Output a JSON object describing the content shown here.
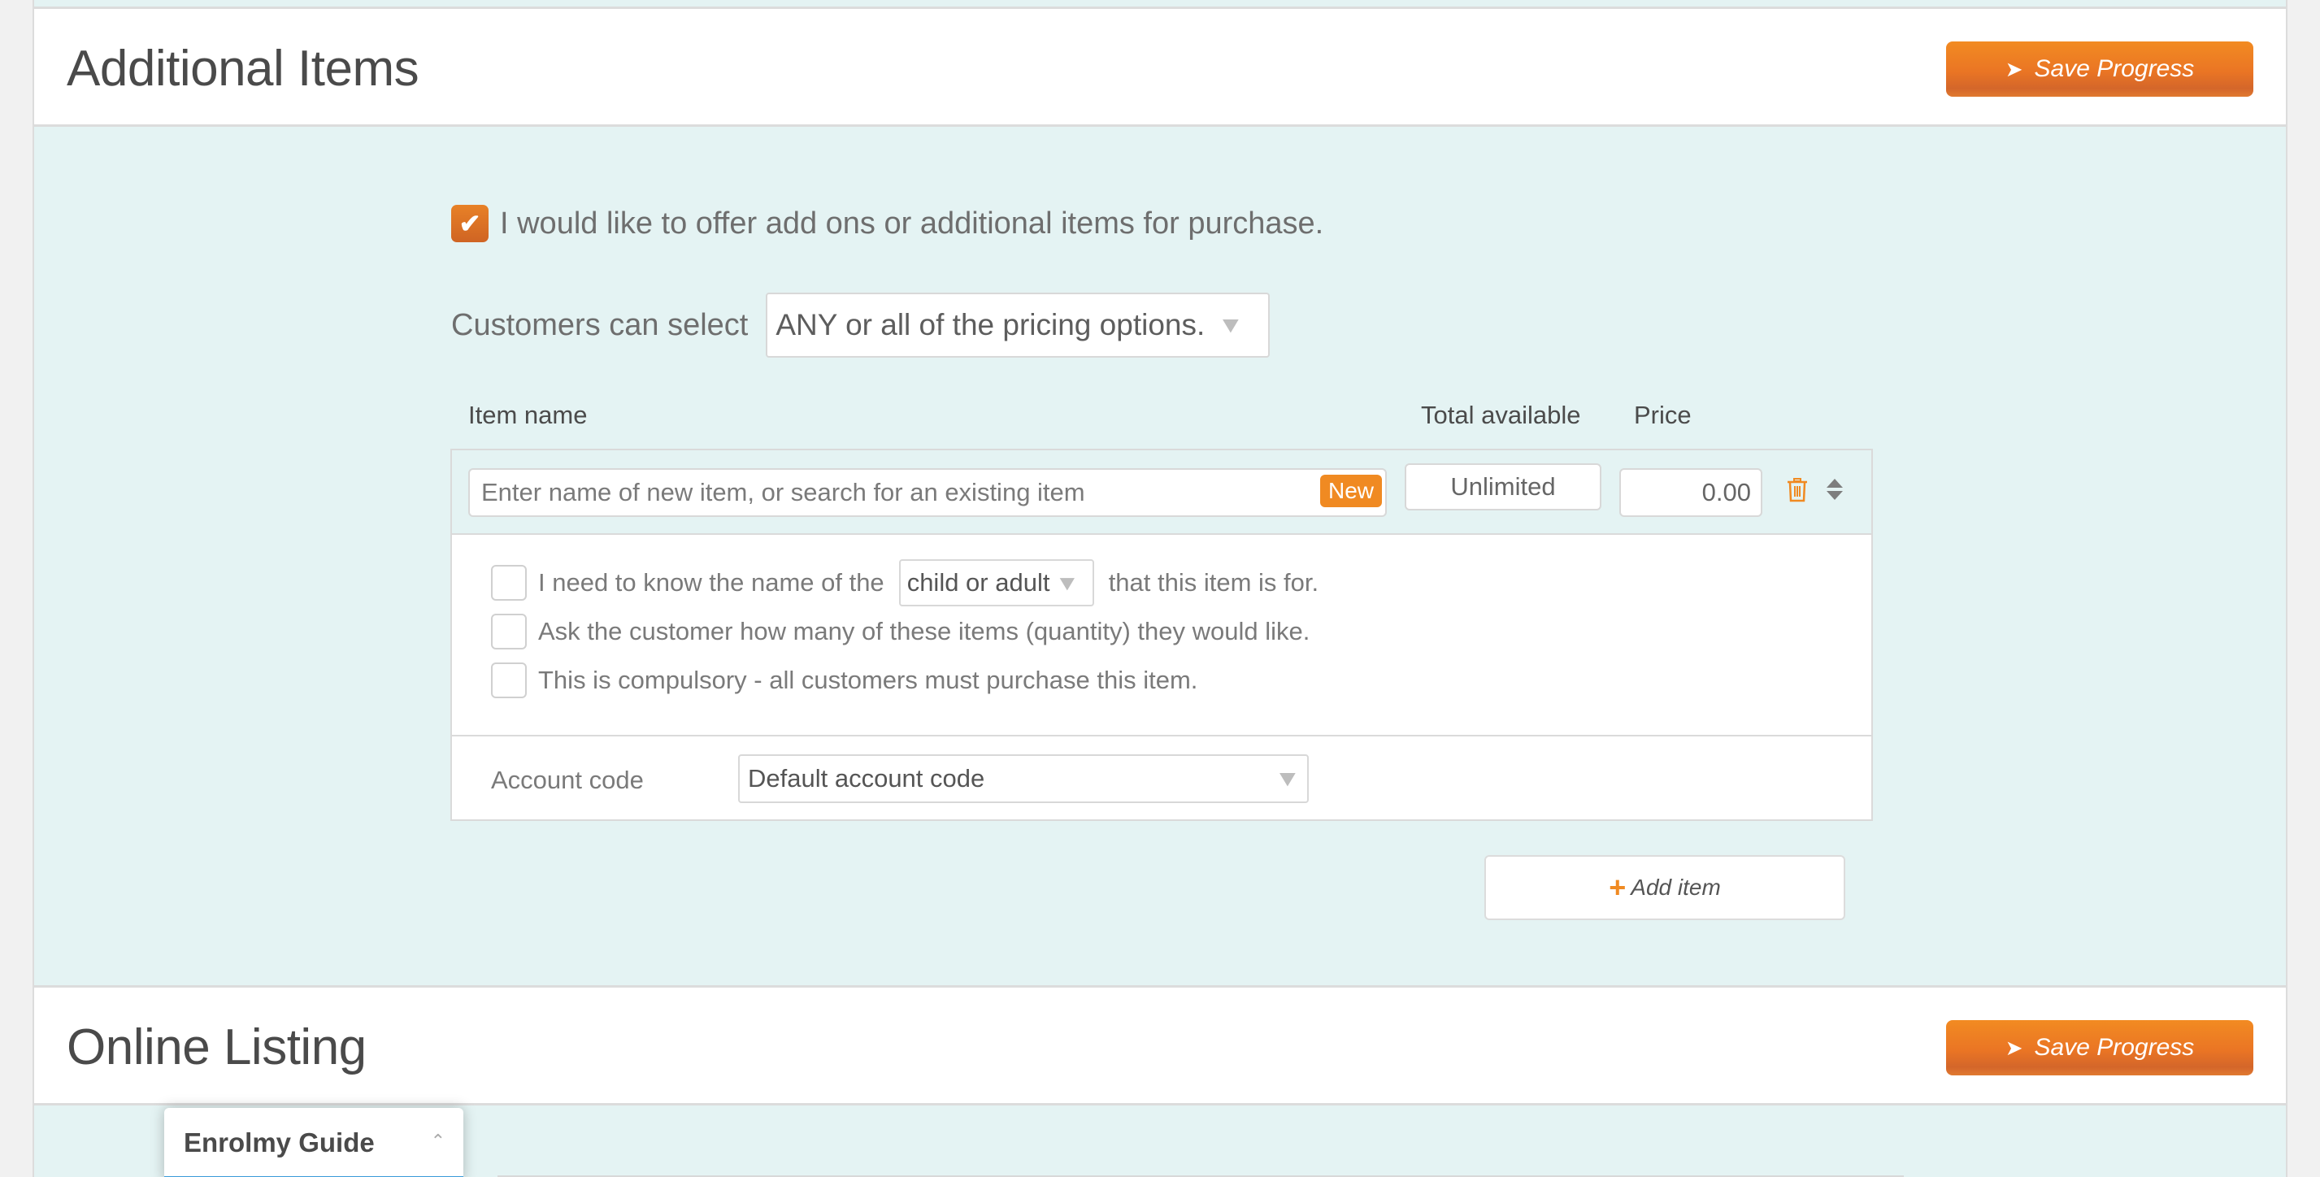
{
  "sections": {
    "additional_items": {
      "title": "Additional Items",
      "save_label": "Save Progress"
    },
    "online_listing": {
      "title": "Online Listing",
      "save_label": "Save Progress"
    }
  },
  "offer": {
    "checked": true,
    "label": "I would like to offer add ons or additional items for purchase."
  },
  "customer_select": {
    "label": "Customers can select",
    "selected": "ANY or all of the pricing options."
  },
  "columns": {
    "item_name": "Item name",
    "total_available": "Total available",
    "price": "Price"
  },
  "item": {
    "name_placeholder": "Enter name of new item, or search for an existing item",
    "new_badge": "New",
    "total_available": "Unlimited",
    "price": "0.00",
    "options": {
      "need_name_prefix": "I need to know the name of the",
      "need_name_select": "child or adult",
      "need_name_suffix": "that this item is for.",
      "ask_quantity": "Ask the customer how many of these items (quantity) they would like.",
      "compulsory": "This is compulsory - all customers must purchase this item."
    },
    "account_code_label": "Account code",
    "account_code_selected": "Default account code"
  },
  "add_item_label": "Add item",
  "guide": {
    "title": "Enrolmy Guide"
  },
  "colors": {
    "accent": "#f08a22",
    "background": "#e4f3f3",
    "guide_bar": "#3a9ad9"
  }
}
